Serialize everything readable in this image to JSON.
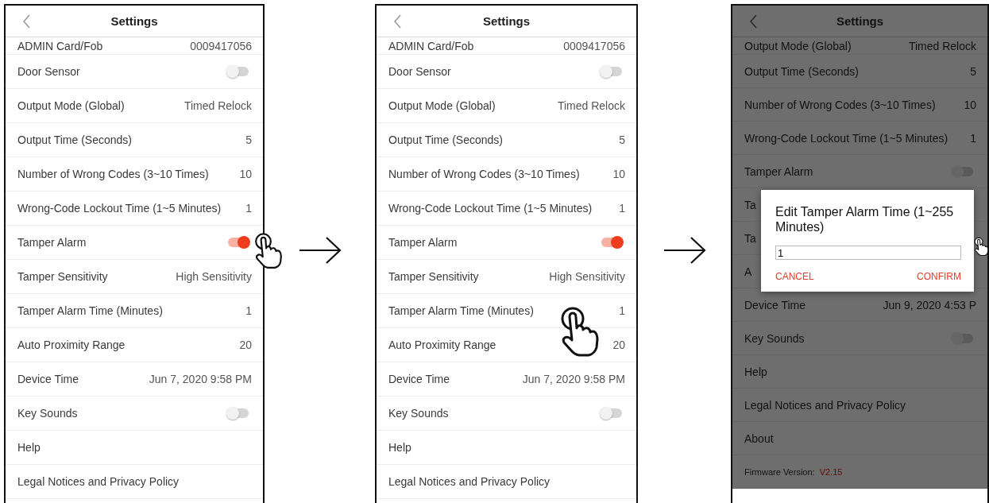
{
  "screens": [
    {
      "title": "Settings",
      "dimmed": false,
      "rows": [
        {
          "kind": "value",
          "partial": true,
          "label": "ADMIN Card/Fob",
          "value": "0009417056"
        },
        {
          "kind": "toggle",
          "label": "Door Sensor",
          "on": false
        },
        {
          "kind": "value",
          "label": "Output Mode (Global)",
          "value": "Timed Relock"
        },
        {
          "kind": "value",
          "label": "Output Time (Seconds)",
          "value": "5"
        },
        {
          "kind": "value",
          "label": "Number of Wrong Codes (3~10 Times)",
          "value": "10"
        },
        {
          "kind": "value",
          "label": "Wrong-Code Lockout Time (1~5 Minutes)",
          "value": "1"
        },
        {
          "kind": "toggle",
          "label": "Tamper Alarm",
          "on": true
        },
        {
          "kind": "value",
          "label": "Tamper Sensitivity",
          "value": "High Sensitivity"
        },
        {
          "kind": "value",
          "label": "Tamper Alarm Time (Minutes)",
          "value": "1"
        },
        {
          "kind": "value",
          "label": "Auto Proximity Range",
          "value": "20"
        },
        {
          "kind": "value",
          "label": "Device Time",
          "value": "Jun 7, 2020 9:58 PM"
        },
        {
          "kind": "toggle",
          "label": "Key Sounds",
          "on": false
        },
        {
          "kind": "value",
          "label": "Help"
        },
        {
          "kind": "value",
          "label": "Legal Notices and Privacy Policy"
        }
      ]
    },
    {
      "title": "Settings",
      "dimmed": false,
      "rows": [
        {
          "kind": "value",
          "partial": true,
          "label": "ADMIN Card/Fob",
          "value": "0009417056"
        },
        {
          "kind": "toggle",
          "label": "Door Sensor",
          "on": false
        },
        {
          "kind": "value",
          "label": "Output Mode (Global)",
          "value": "Timed Relock"
        },
        {
          "kind": "value",
          "label": "Output Time (Seconds)",
          "value": "5"
        },
        {
          "kind": "value",
          "label": "Number of Wrong Codes (3~10 Times)",
          "value": "10"
        },
        {
          "kind": "value",
          "label": "Wrong-Code Lockout Time (1~5 Minutes)",
          "value": "1"
        },
        {
          "kind": "toggle",
          "label": "Tamper Alarm",
          "on": true
        },
        {
          "kind": "value",
          "label": "Tamper Sensitivity",
          "value": "High Sensitivity"
        },
        {
          "kind": "value",
          "label": "Tamper Alarm Time (Minutes)",
          "value": "1"
        },
        {
          "kind": "value",
          "label": "Auto Proximity Range",
          "value": "20"
        },
        {
          "kind": "value",
          "label": "Device Time",
          "value": "Jun 7, 2020 9:58 PM"
        },
        {
          "kind": "toggle",
          "label": "Key Sounds",
          "on": false
        },
        {
          "kind": "value",
          "label": "Help"
        },
        {
          "kind": "value",
          "label": "Legal Notices and Privacy Policy"
        }
      ]
    },
    {
      "title": "Settings",
      "dimmed": true,
      "rows": [
        {
          "kind": "value",
          "partial": true,
          "label": "Output Mode (Global)",
          "value": "Timed Relock"
        },
        {
          "kind": "value",
          "label": "Output Time (Seconds)",
          "value": "5"
        },
        {
          "kind": "value",
          "label": "Number of Wrong Codes (3~10 Times)",
          "value": "10"
        },
        {
          "kind": "value",
          "label": "Wrong-Code Lockout Time (1~5 Minutes)",
          "value": "1"
        },
        {
          "kind": "toggle",
          "label": "Tamper Alarm",
          "on": false
        },
        {
          "kind": "value",
          "label": "Ta"
        },
        {
          "kind": "value",
          "label": "Ta"
        },
        {
          "kind": "value",
          "label": "A"
        },
        {
          "kind": "value",
          "label": "Device Time",
          "value": "Jun 9, 2020 4:53 P"
        },
        {
          "kind": "toggle",
          "label": "Key Sounds",
          "on": false
        },
        {
          "kind": "value",
          "label": "Help"
        },
        {
          "kind": "value",
          "label": "Legal Notices and Privacy Policy"
        },
        {
          "kind": "value",
          "label": "About"
        },
        {
          "kind": "firmware",
          "label": "Firmware Version:",
          "value": "V2.15"
        }
      ],
      "dialog": {
        "title": "Edit Tamper Alarm Time (1~255 Minutes)",
        "input": "1",
        "buttons": [
          {
            "label": "CANCEL"
          },
          {
            "label": "CONFIRM"
          }
        ]
      }
    }
  ]
}
